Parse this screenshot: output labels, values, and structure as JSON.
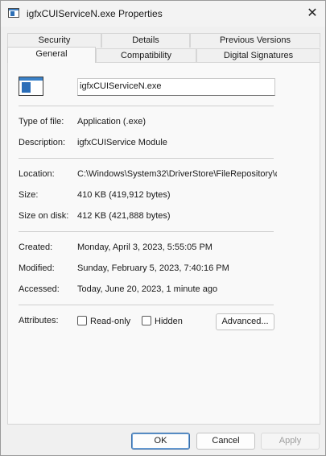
{
  "window": {
    "title": "igfxCUIServiceN.exe Properties",
    "close_glyph": "✕",
    "icon": "app-window-icon"
  },
  "tabs": {
    "row1": [
      "Security",
      "Details",
      "Previous Versions"
    ],
    "row2": [
      "General",
      "Compatibility",
      "Digital Signatures"
    ],
    "active": "General"
  },
  "general": {
    "file_icon": "app-window-icon",
    "file_name": "igfxCUIServiceN.exe",
    "type_label": "Type of file:",
    "type_value": "Application (.exe)",
    "description_label": "Description:",
    "description_value": "igfxCUIService Module",
    "location_label": "Location:",
    "location_value": "C:\\Windows\\System32\\DriverStore\\FileRepository\\c",
    "size_label": "Size:",
    "size_value": "410 KB (419,912 bytes)",
    "size_on_disk_label": "Size on disk:",
    "size_on_disk_value": "412 KB (421,888 bytes)",
    "created_label": "Created:",
    "created_value": "Monday, April 3, 2023, 5:55:05 PM",
    "modified_label": "Modified:",
    "modified_value": "Sunday, February 5, 2023, 7:40:16 PM",
    "accessed_label": "Accessed:",
    "accessed_value": "Today, June 20, 2023, 1 minute ago",
    "attributes_label": "Attributes:",
    "readonly_label": "Read-only",
    "readonly_checked": false,
    "hidden_label": "Hidden",
    "hidden_checked": false,
    "advanced_label": "Advanced..."
  },
  "footer": {
    "ok_label": "OK",
    "cancel_label": "Cancel",
    "apply_label": "Apply"
  }
}
